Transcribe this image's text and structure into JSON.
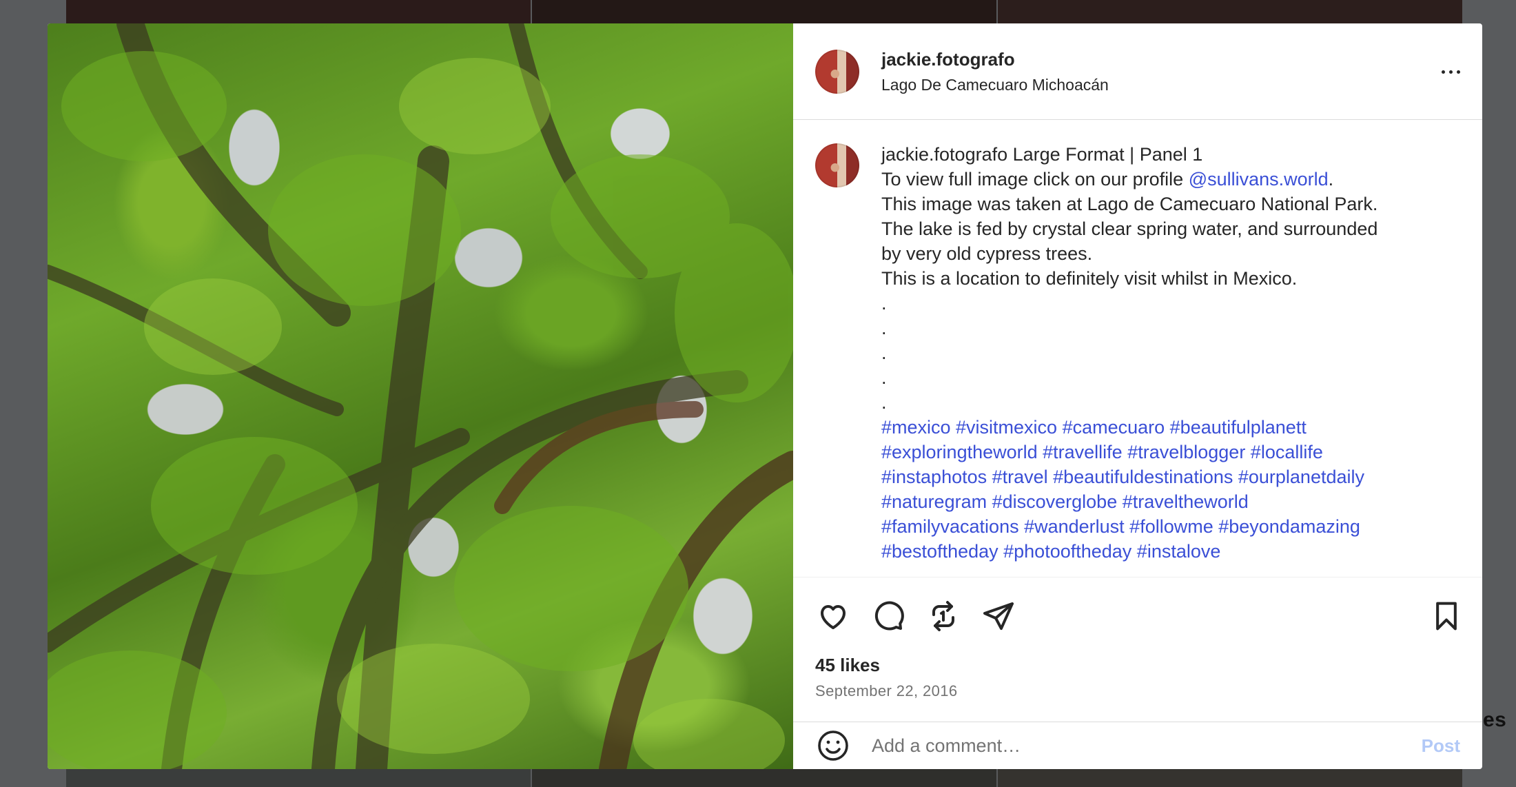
{
  "background": {
    "peek_text": "es"
  },
  "post": {
    "username": "jackie.fotografo",
    "location": "Lago De Camecuaro Michoacán",
    "caption": {
      "username": "jackie.fotografo",
      "line1_text": " Large Format | Panel 1",
      "line2_text": "To view full image click on our profile ",
      "line2_mention": "@sullivans.world",
      "line2_end": ".",
      "lines": [
        "This image was taken at Lago de Camecuaro National Park.",
        "The lake is fed by crystal clear spring water, and surrounded",
        "by very old cypress trees.",
        "This is a location to definitely visit whilst in Mexico.",
        ".",
        ".",
        ".",
        ".",
        "."
      ],
      "hashtag_lines": [
        "#mexico #visitmexico #camecuaro #beautifulplanett",
        "#exploringtheworld #travellife #travelblogger #locallife",
        "#instaphotos #travel #beautifuldestinations #ourplanetdaily",
        "#naturegram #discoverglobe #traveltheworld",
        "#familyvacations #wanderlust #followme #beyondamazing",
        "#bestoftheday #photooftheday #instalove"
      ]
    },
    "likes": "45 likes",
    "date": "September 22, 2016",
    "comment_placeholder": "Add a comment…",
    "post_label": "Post",
    "icons": {
      "more": "more-options-icon",
      "like": "heart-icon",
      "comment": "comment-icon",
      "repost": "repost-icon",
      "share": "share-icon",
      "save": "bookmark-icon",
      "emoji": "emoji-icon"
    },
    "colors": {
      "link": "#3a4fd6",
      "post_disabled": "#b2c9f7",
      "secondary_text": "#737373"
    }
  }
}
